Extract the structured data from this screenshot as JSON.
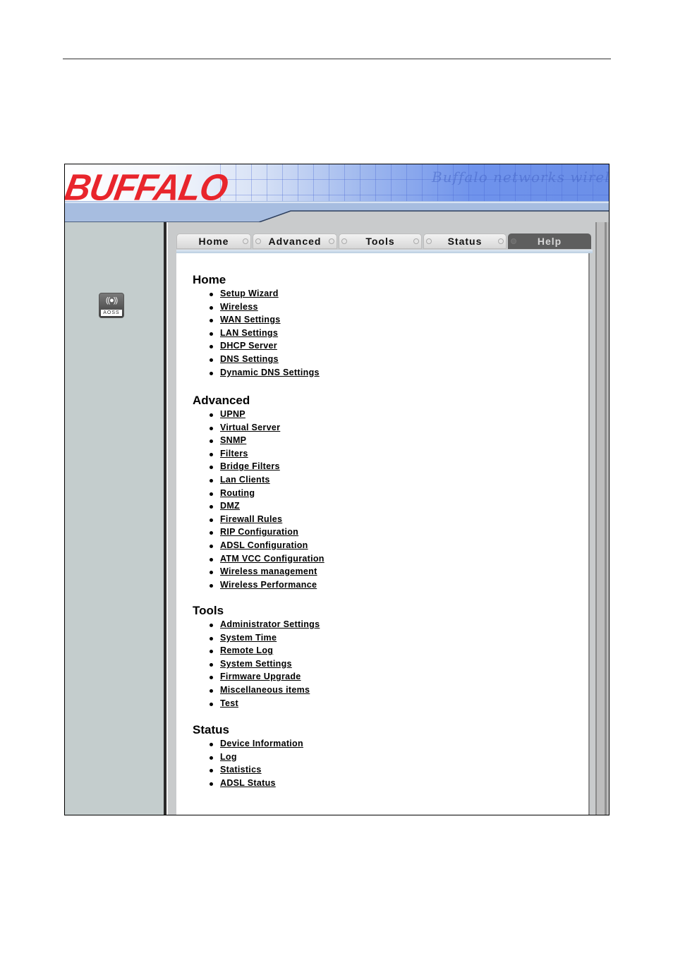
{
  "brand": {
    "logo_text": "BUFFALO",
    "banner_script": "Buffalo networks wireless",
    "accent_red": "#e8252c",
    "banner_blue": "#6b8fe8"
  },
  "sidebar": {
    "aoss_button": {
      "icon": "aoss-wireless-icon",
      "label": "AOSS"
    }
  },
  "tabs": [
    {
      "label": "Home",
      "active": false
    },
    {
      "label": "Advanced",
      "active": false
    },
    {
      "label": "Tools",
      "active": false
    },
    {
      "label": "Status",
      "active": false
    },
    {
      "label": "Help",
      "active": true
    }
  ],
  "sections": [
    {
      "title": "Home",
      "links": [
        "Setup Wizard",
        "Wireless",
        "WAN Settings",
        "LAN Settings",
        "DHCP Server",
        "DNS Settings",
        "Dynamic DNS Settings"
      ]
    },
    {
      "title": "Advanced",
      "links": [
        "UPNP",
        "Virtual Server",
        "SNMP",
        "Filters",
        "Bridge Filters",
        "Lan Clients",
        "Routing",
        "DMZ",
        "Firewall Rules",
        "RIP Configuration",
        "ADSL Configuration",
        "ATM VCC Configuration",
        "Wireless management",
        "Wireless Performance"
      ]
    },
    {
      "title": "Tools",
      "links": [
        "Administrator Settings",
        "System Time",
        "Remote Log",
        "System Settings",
        "Firmware Upgrade",
        "Miscellaneous items",
        "Test"
      ]
    },
    {
      "title": "Status",
      "links": [
        "Device Information",
        "Log",
        "Statistics",
        "ADSL Status"
      ]
    }
  ]
}
